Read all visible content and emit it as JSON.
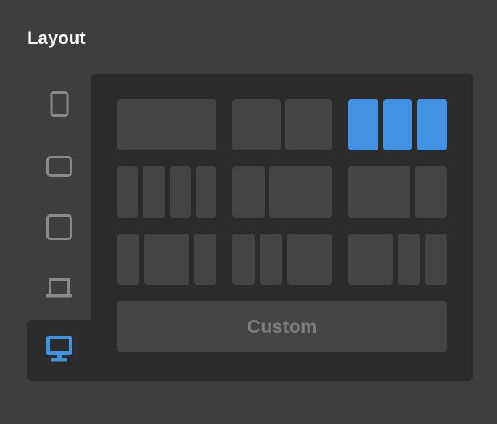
{
  "panel": {
    "title": "Layout"
  },
  "devices": [
    {
      "name": "phone",
      "icon": "phone-icon",
      "selected": false
    },
    {
      "name": "tablet-landscape",
      "icon": "tablet-landscape-icon",
      "selected": false
    },
    {
      "name": "tablet-portrait",
      "icon": "tablet-icon",
      "selected": false
    },
    {
      "name": "laptop",
      "icon": "laptop-icon",
      "selected": false
    },
    {
      "name": "desktop",
      "icon": "desktop-icon",
      "selected": true
    }
  ],
  "layouts": {
    "selected_option": "layout-3-equal-columns",
    "custom_label": "Custom"
  },
  "colors": {
    "background": "#3e3e3e",
    "panel": "#2b2b2b",
    "tile": "#444444",
    "accent": "#4291e2",
    "icon_inactive": "#8a8a8a",
    "title_text": "#ffffff",
    "custom_text": "#7c7c7c"
  }
}
